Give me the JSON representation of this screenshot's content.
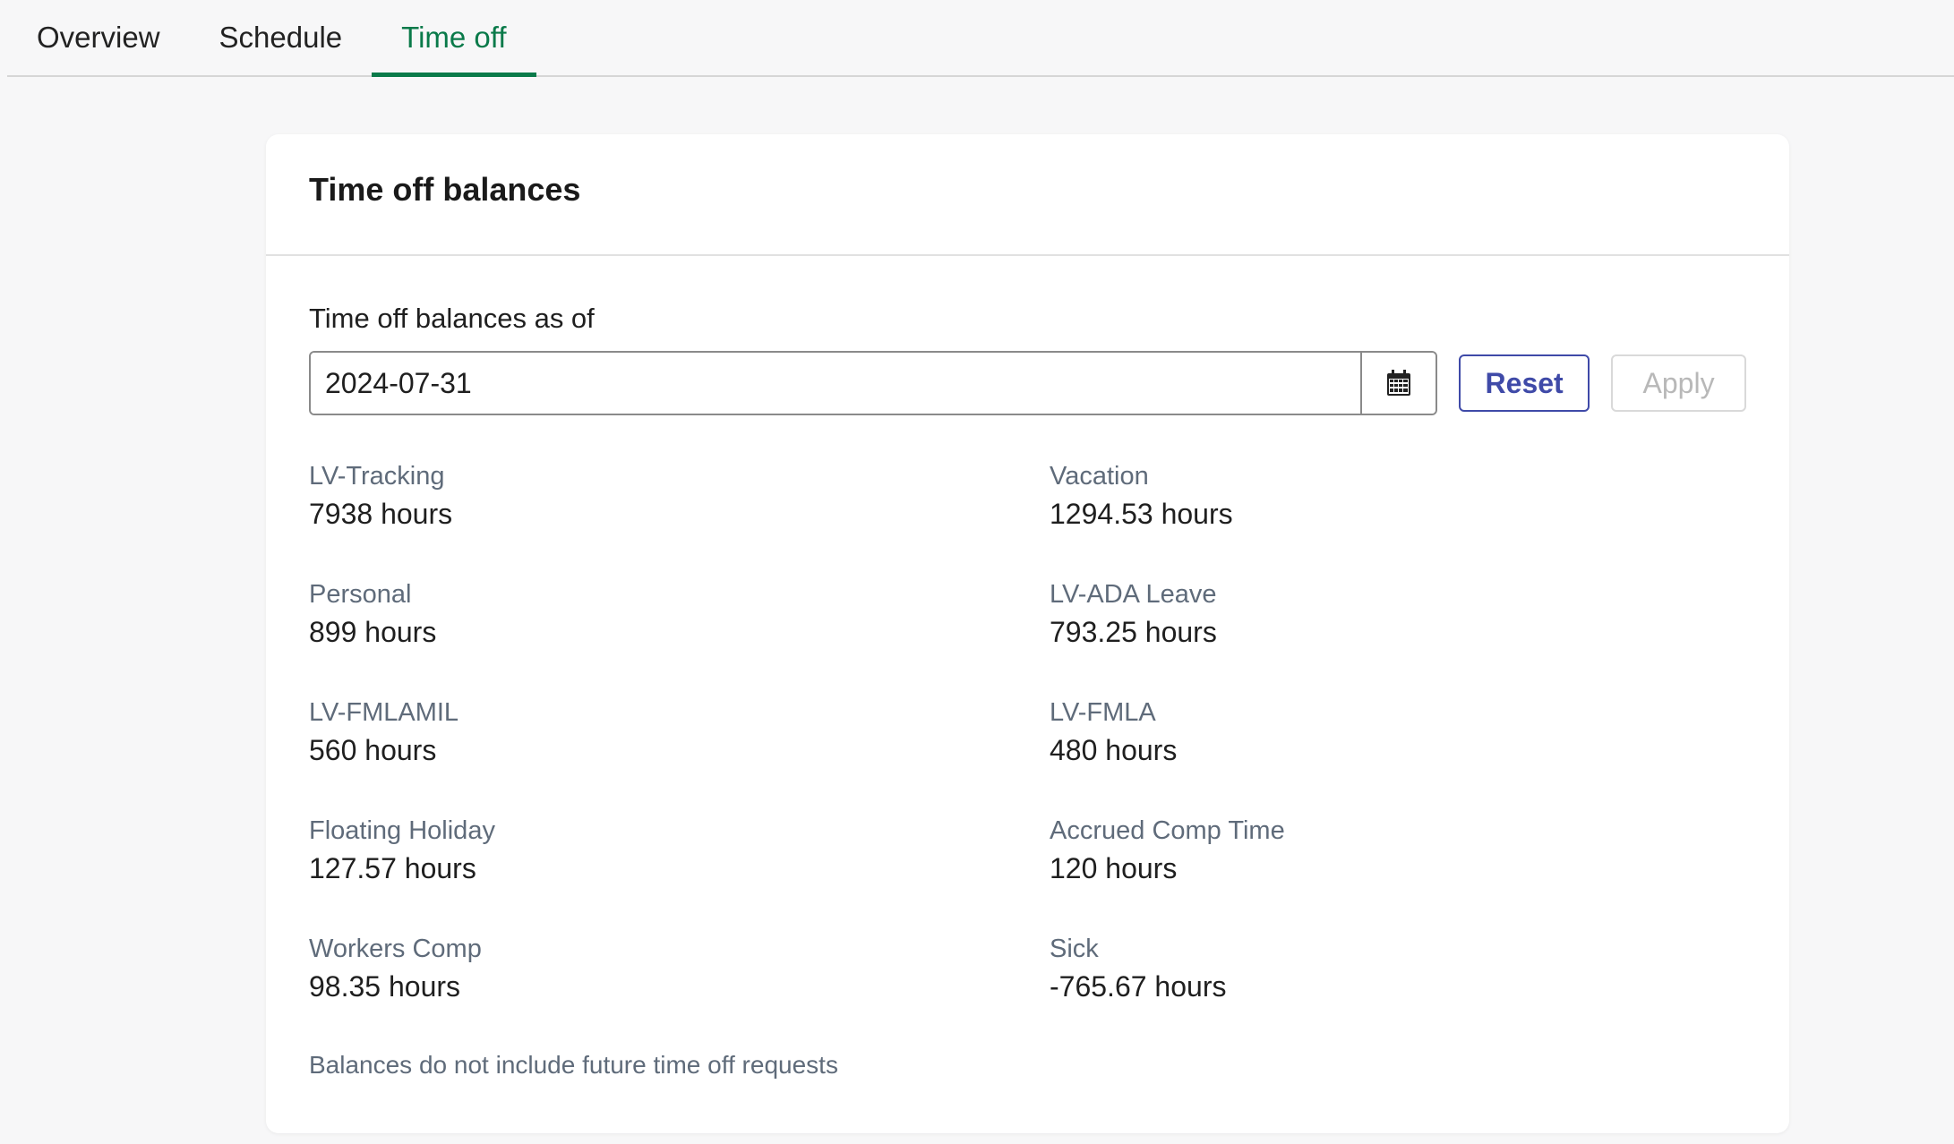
{
  "tabs": [
    {
      "label": "Overview",
      "active": false
    },
    {
      "label": "Schedule",
      "active": false
    },
    {
      "label": "Time off",
      "active": true
    }
  ],
  "accent_color": "#0a7a4a",
  "card": {
    "title": "Time off balances",
    "asof_label": "Time off balances as of",
    "date_value": "2024-07-31",
    "calendar_icon": "calendar-icon",
    "reset_label": "Reset",
    "apply_label": "Apply",
    "balances": [
      {
        "name": "LV-Tracking",
        "value": "7938 hours"
      },
      {
        "name": "Vacation",
        "value": "1294.53 hours"
      },
      {
        "name": "Personal",
        "value": "899 hours"
      },
      {
        "name": "LV-ADA Leave",
        "value": "793.25 hours"
      },
      {
        "name": "LV-FMLAMIL",
        "value": "560 hours"
      },
      {
        "name": "LV-FMLA",
        "value": "480 hours"
      },
      {
        "name": "Floating Holiday",
        "value": "127.57 hours"
      },
      {
        "name": "Accrued Comp Time",
        "value": "120 hours"
      },
      {
        "name": "Workers Comp",
        "value": "98.35 hours"
      },
      {
        "name": "Sick",
        "value": "-765.67 hours"
      }
    ],
    "footnote": "Balances do not include future time off requests"
  }
}
